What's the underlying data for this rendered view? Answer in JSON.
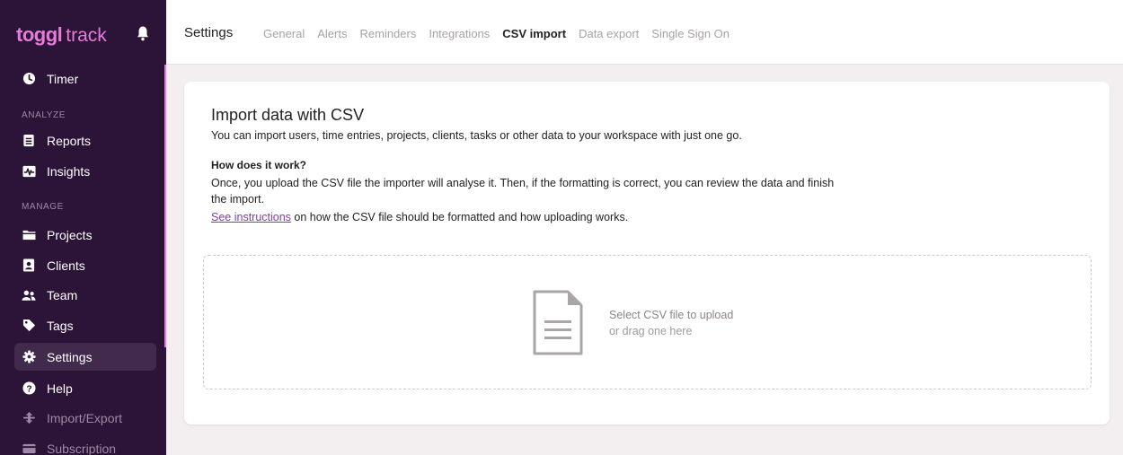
{
  "brand": {
    "name": "toggl",
    "product": "track"
  },
  "sidebar": {
    "sections": {
      "analyze": "ANALYZE",
      "manage": "MANAGE"
    },
    "items": [
      {
        "label": "Timer",
        "icon": "clock-icon"
      },
      {
        "label": "Reports",
        "icon": "document-icon"
      },
      {
        "label": "Insights",
        "icon": "insights-icon"
      },
      {
        "label": "Projects",
        "icon": "folder-icon"
      },
      {
        "label": "Clients",
        "icon": "contact-card-icon"
      },
      {
        "label": "Team",
        "icon": "team-icon"
      },
      {
        "label": "Tags",
        "icon": "tag-icon"
      },
      {
        "label": "Settings",
        "icon": "gear-icon",
        "active": true
      },
      {
        "label": "Help",
        "icon": "help-icon"
      },
      {
        "label": "Import/Export",
        "icon": "import-export-icon"
      },
      {
        "label": "Subscription",
        "icon": "credit-card-icon"
      }
    ]
  },
  "topbar": {
    "title": "Settings",
    "tabs": [
      {
        "label": "General"
      },
      {
        "label": "Alerts"
      },
      {
        "label": "Reminders"
      },
      {
        "label": "Integrations"
      },
      {
        "label": "CSV import",
        "active": true
      },
      {
        "label": "Data export"
      },
      {
        "label": "Single Sign On"
      }
    ]
  },
  "import": {
    "title": "Import data with CSV",
    "subtitle": "You can import users, time entries, projects, clients, tasks or other data to your workspace with just one go.",
    "how_title": "How does it work?",
    "how_body": "Once, you upload the CSV file the importer will analyse it. Then, if the formatting is correct, you can review the data and finish the import.",
    "link_text": "See instructions",
    "link_suffix": " on how the CSV file should be formatted and how uploading works.",
    "dropzone": {
      "primary": "Select CSV file to upload",
      "secondary": "or drag one here"
    }
  },
  "colors": {
    "sidebar_bg": "#2c1338",
    "accent": "#e57cd8",
    "link": "#7d3fa0"
  }
}
